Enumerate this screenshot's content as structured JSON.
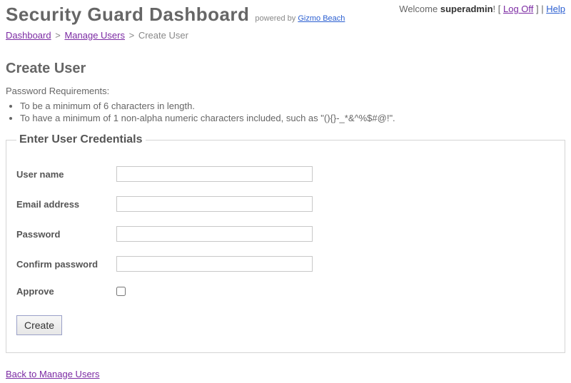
{
  "header": {
    "app_title": "Security Guard Dashboard",
    "powered_by_prefix": "powered by ",
    "powered_by_link": "Gizmo Beach"
  },
  "welcome": {
    "prefix": "Welcome ",
    "username": "superadmin",
    "excl": "!",
    "open_bracket": " [ ",
    "logoff": "Log Off",
    "close_bracket": " ]",
    "pipe": " | ",
    "help": "Help"
  },
  "breadcrumb": {
    "dashboard": "Dashboard",
    "sep": ">",
    "manage_users": "Manage Users",
    "current": "Create User"
  },
  "page": {
    "heading": "Create User",
    "reqs_title": "Password Requirements:",
    "reqs": [
      "To be a minimum of 6 characters in length.",
      "To have a minimum of 1 non-alpha numeric characters included, such as \"(){}-_*&^%$#@!\"."
    ]
  },
  "form": {
    "legend": "Enter User Credentials",
    "username_label": "User name",
    "email_label": "Email address",
    "password_label": "Password",
    "confirm_label": "Confirm password",
    "approve_label": "Approve",
    "create_button": "Create",
    "values": {
      "username": "",
      "email": "",
      "password": "",
      "confirm": ""
    }
  },
  "footer": {
    "back_link": "Back to Manage Users"
  }
}
